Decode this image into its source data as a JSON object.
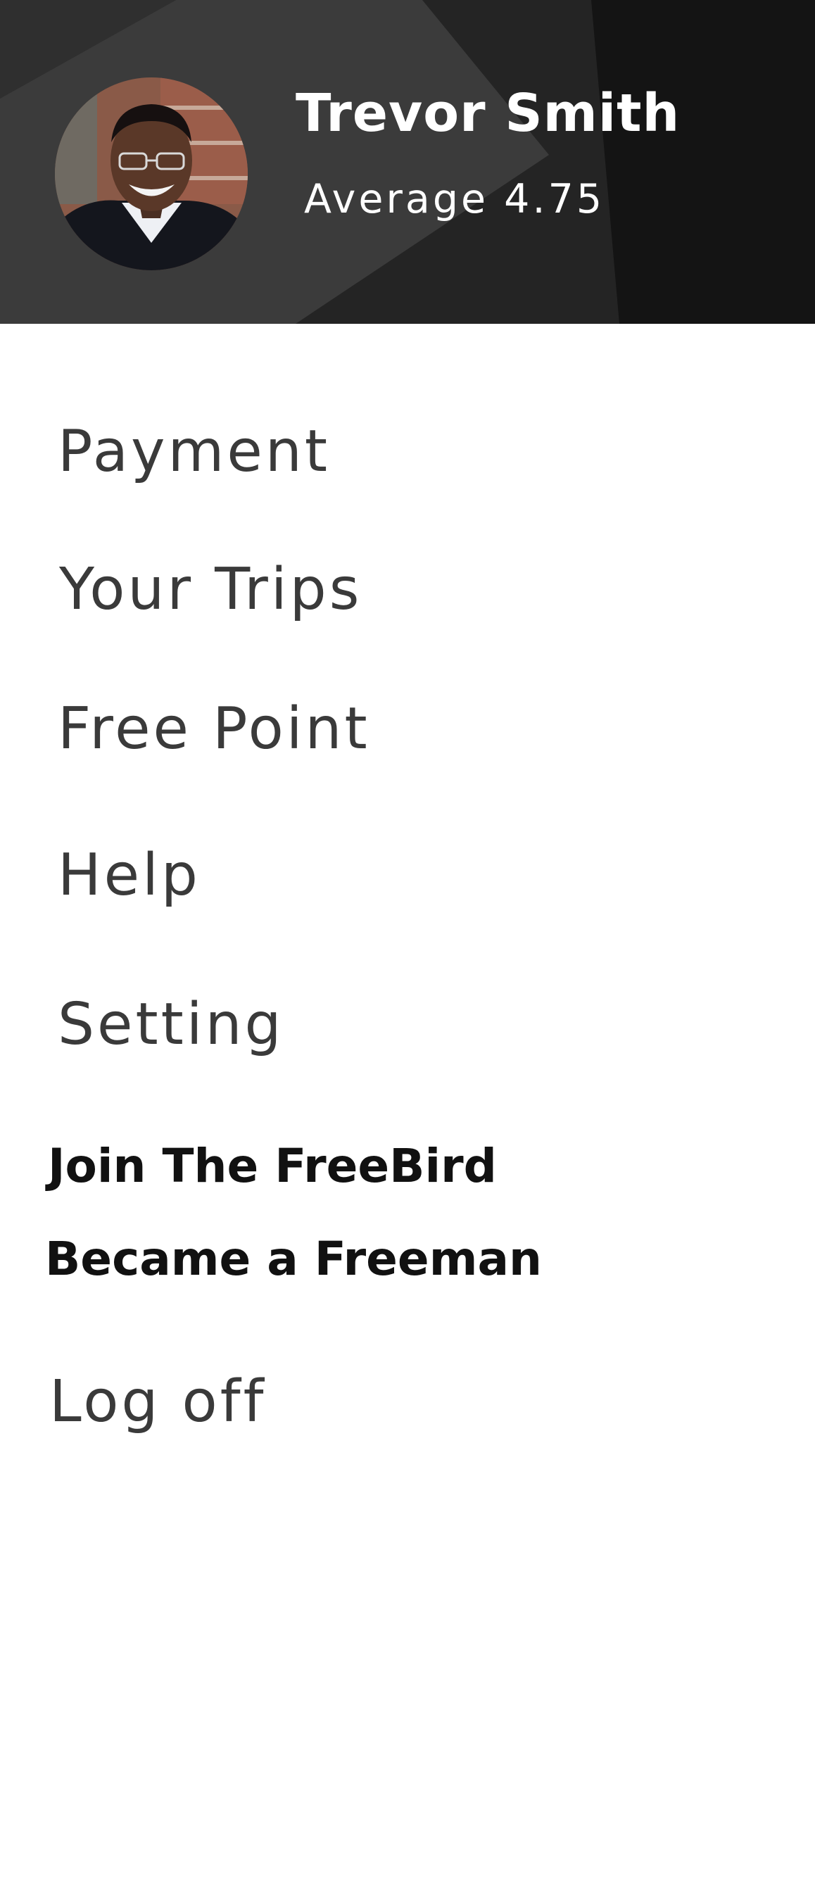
{
  "profile": {
    "name": "Trevor Smith",
    "rating": "Average 4.75"
  },
  "menu": {
    "payment": "Payment",
    "trips": "Your Trips",
    "free_point": "Free Point",
    "help": "Help",
    "setting": "Setting",
    "join": "Join The FreeBird",
    "freeman": "Became a Freeman",
    "logoff": "Log off"
  },
  "colors": {
    "header_dark": "#141414",
    "header_mid": "#2a2a2a",
    "header_light": "#3a3a3a",
    "menu_text": "#3a3a3a",
    "menu_bold_text": "#111111"
  }
}
